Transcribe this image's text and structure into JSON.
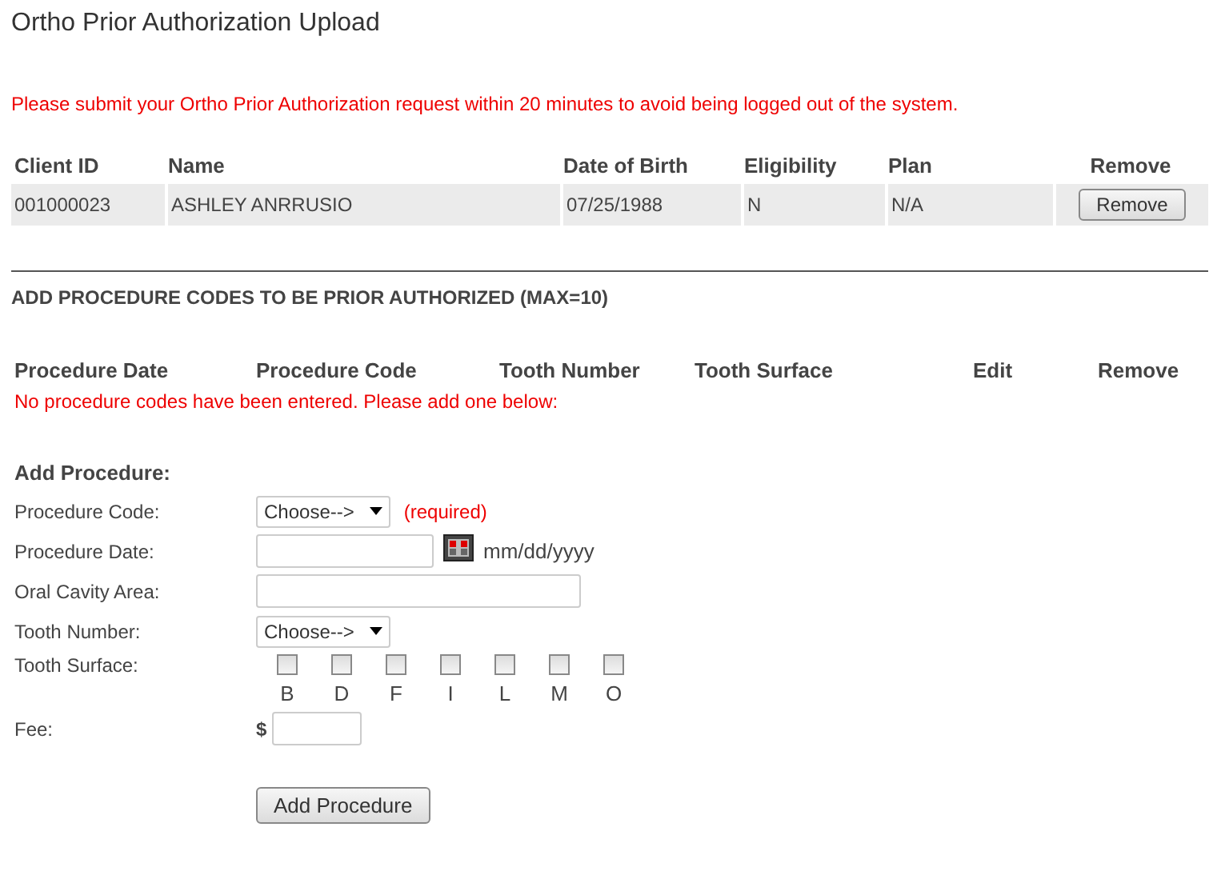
{
  "page_title": "Ortho Prior Authorization Upload",
  "warning": "Please submit your Ortho Prior Authorization request within 20 minutes to avoid being logged out of the system.",
  "client_table": {
    "columns": [
      "Client ID",
      "Name",
      "Date of Birth",
      "Eligibility",
      "Plan",
      "Remove"
    ],
    "rows": [
      {
        "cells": [
          "001000023",
          "ASHLEY ANRRUSIO",
          "07/25/1988",
          "N",
          "N/A"
        ],
        "button": "Remove"
      }
    ]
  },
  "procedures": {
    "heading": "ADD PROCEDURE CODES TO BE PRIOR AUTHORIZED (MAX=10)",
    "columns": [
      "Procedure Date",
      "Procedure Code",
      "Tooth Number",
      "Tooth Surface",
      "Edit",
      "Remove"
    ],
    "empty_message": "No procedure codes have been entered. Please add one below:"
  },
  "form": {
    "heading": "Add Procedure:",
    "procedure_code": {
      "label": "Procedure Code:",
      "value": "Choose-->",
      "note": "(required)"
    },
    "procedure_date": {
      "label": "Procedure Date:",
      "hint": "mm/dd/yyyy"
    },
    "oral_cavity_area": {
      "label": "Oral Cavity Area:"
    },
    "tooth_number": {
      "label": "Tooth Number:",
      "value": "Choose-->"
    },
    "tooth_surface": {
      "label": "Tooth Surface:",
      "options": [
        {
          "label": "B",
          "checked": false
        },
        {
          "label": "D",
          "checked": false
        },
        {
          "label": "F",
          "checked": false
        },
        {
          "label": "I",
          "checked": false
        },
        {
          "label": "L",
          "checked": false
        },
        {
          "label": "M",
          "checked": false
        },
        {
          "label": "O",
          "checked": false
        }
      ]
    },
    "fee": {
      "label": "Fee:",
      "currency": "$"
    },
    "submit": "Add Procedure"
  }
}
